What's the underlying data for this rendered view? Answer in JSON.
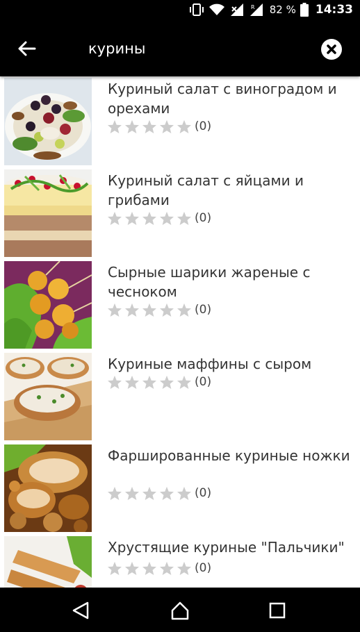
{
  "status_bar": {
    "battery_percent": "82 %",
    "time": "14:33",
    "icons": [
      "vibrate-icon",
      "wifi-icon",
      "signal-icon",
      "signal-roaming-icon",
      "battery-icon"
    ]
  },
  "toolbar": {
    "back_icon": "arrow-back-icon",
    "search_query": "курины",
    "clear_icon": "close-circle-icon"
  },
  "results": [
    {
      "title": "Куриный салат с виноградом и орехами",
      "rating_count": "(0)",
      "stars_filled": 0,
      "image": "chicken-salad-grapes-walnuts"
    },
    {
      "title": "Куриный салат с яйцами и грибами",
      "rating_count": "(0)",
      "stars_filled": 0,
      "image": "layered-salad-cranberries"
    },
    {
      "title": "Сырные шарики жареные с чесноком",
      "rating_count": "(0)",
      "stars_filled": 0,
      "image": "fried-cheese-balls"
    },
    {
      "title": "Куриные маффины с сыром",
      "rating_count": "(0)",
      "stars_filled": 0,
      "image": "chicken-cheese-muffins"
    },
    {
      "title": "Фаршированные куриные ножки",
      "rating_count": "(0)",
      "stars_filled": 0,
      "image": "stuffed-chicken-legs"
    },
    {
      "title": "Хрустящие куриные \"Пальчики\"",
      "rating_count": "(0)",
      "stars_filled": 0,
      "image": "crispy-chicken-fingers"
    }
  ],
  "nav_bar": {
    "back_icon": "nav-back-icon",
    "home_icon": "nav-home-icon",
    "recents_icon": "nav-recents-icon"
  },
  "colors": {
    "toolbar_bg": "#000000",
    "title_text": "#333333",
    "star_empty": "#cccccc"
  }
}
